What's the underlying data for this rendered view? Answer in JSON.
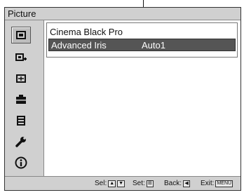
{
  "window": {
    "title": "Picture"
  },
  "sidebar": {
    "items": [
      {
        "icon": "picture-icon",
        "selected": true
      },
      {
        "icon": "advanced-picture-icon",
        "selected": false
      },
      {
        "icon": "screen-icon",
        "selected": false
      },
      {
        "icon": "setup-icon",
        "selected": false
      },
      {
        "icon": "function-icon",
        "selected": false
      },
      {
        "icon": "installation-icon",
        "selected": false
      },
      {
        "icon": "information-icon",
        "selected": false
      }
    ]
  },
  "menu": {
    "items": [
      {
        "label": "Cinema Black Pro",
        "value": ""
      },
      {
        "label": "Advanced Iris",
        "value": "Auto1",
        "highlighted": true
      }
    ]
  },
  "footer": {
    "sel_label": "Sel:",
    "set_label": "Set:",
    "back_label": "Back:",
    "exit_label": "Exit:",
    "exit_key": "MENU"
  },
  "colors": {
    "panel": "#d0d0d0",
    "highlight": "#555555",
    "content_bg": "#ffffff"
  }
}
